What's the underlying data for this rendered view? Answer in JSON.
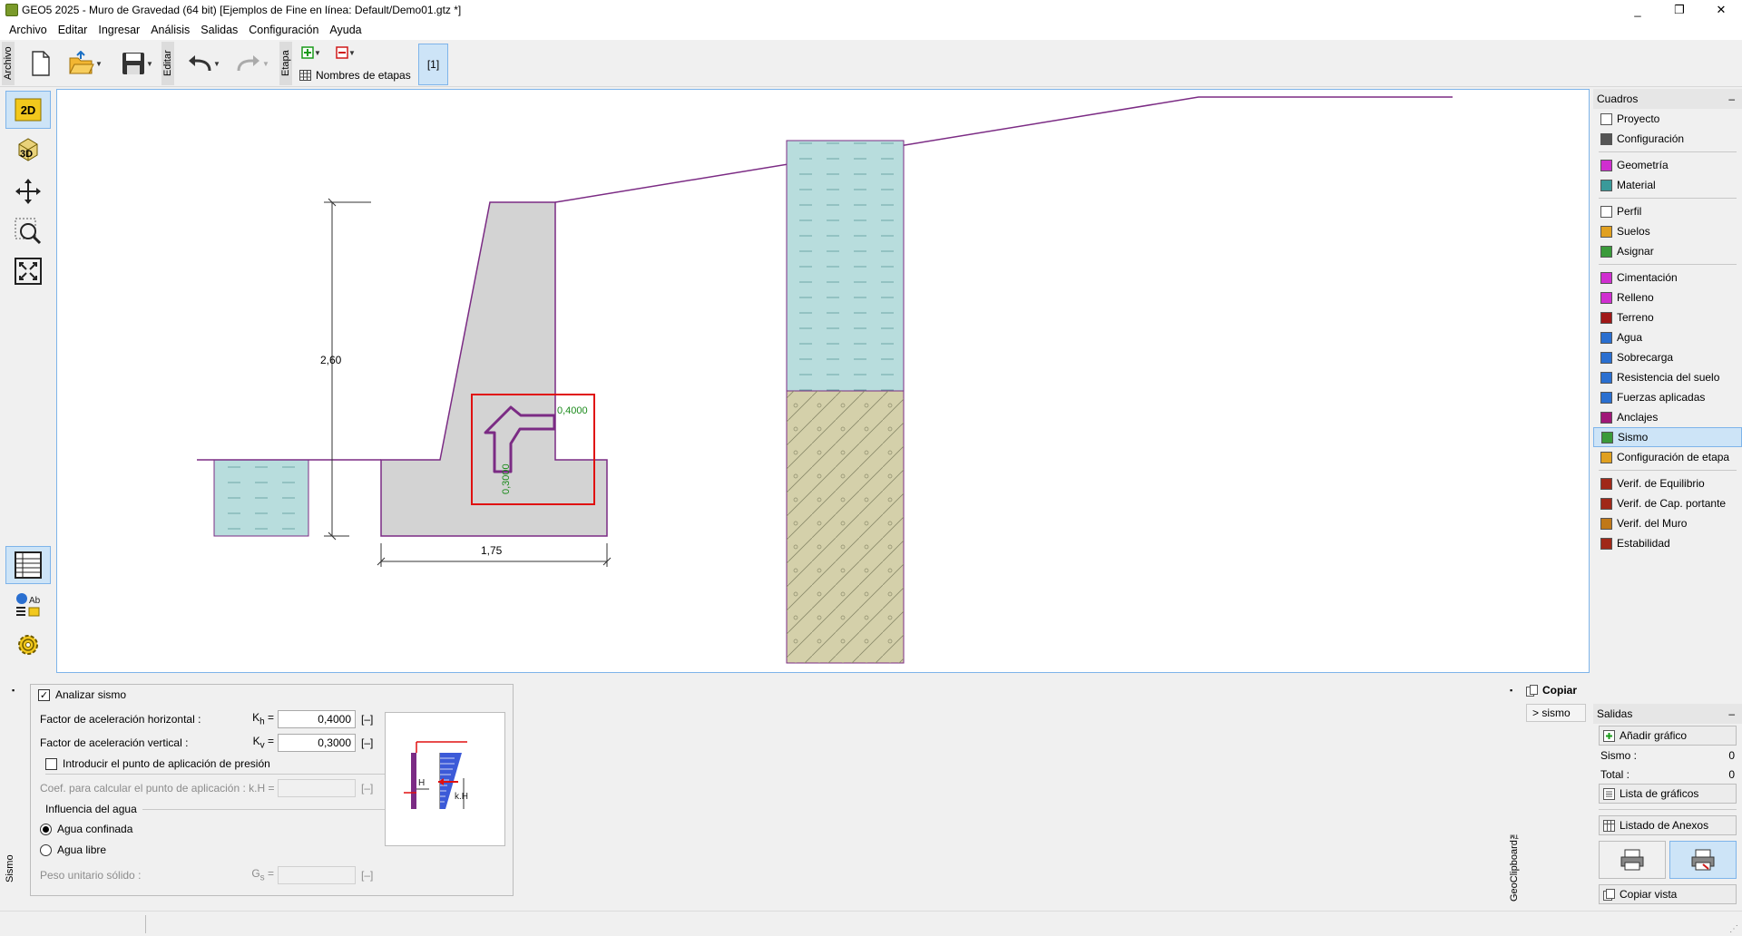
{
  "window": {
    "title": "GEO5 2025 - Muro de Gravedad (64 bit) [Ejemplos de Fine en línea: Default/Demo01.gtz *]",
    "controls": [
      "_",
      "❐",
      "✕"
    ]
  },
  "menu": [
    "Archivo",
    "Editar",
    "Ingresar",
    "Análisis",
    "Salidas",
    "Configuración",
    "Ayuda"
  ],
  "toolbar": {
    "archivo_label": "Archivo",
    "editar_label": "Editar",
    "etapa_label": "Etapa",
    "stage_names_label": "Nombres de etapas",
    "stage_tab": "[1]"
  },
  "leftbar": {
    "view2d": "2D",
    "view3d": "3D"
  },
  "drawing": {
    "height_dim": "2,60",
    "width_dim": "1,75",
    "kh_value": "0,4000",
    "kv_value": "0,3000"
  },
  "cuadros": {
    "title": "Cuadros",
    "collapse": "–",
    "groups": [
      [
        {
          "label": "Proyecto",
          "icon": "document-icon"
        },
        {
          "label": "Configuración",
          "icon": "gear-icon"
        }
      ],
      [
        {
          "label": "Geometría",
          "icon": "geometry-icon"
        },
        {
          "label": "Material",
          "icon": "material-icon"
        }
      ],
      [
        {
          "label": "Perfil",
          "icon": "profile-icon"
        },
        {
          "label": "Suelos",
          "icon": "soil-icon"
        },
        {
          "label": "Asignar",
          "icon": "assign-icon"
        }
      ],
      [
        {
          "label": "Cimentación",
          "icon": "foundation-icon"
        },
        {
          "label": "Relleno",
          "icon": "backfill-icon"
        },
        {
          "label": "Terreno",
          "icon": "terrain-icon"
        },
        {
          "label": "Agua",
          "icon": "water-icon"
        },
        {
          "label": "Sobrecarga",
          "icon": "surcharge-icon"
        },
        {
          "label": "Resistencia del suelo",
          "icon": "resistance-icon"
        },
        {
          "label": "Fuerzas aplicadas",
          "icon": "force-icon"
        },
        {
          "label": "Anclajes",
          "icon": "anchor-icon"
        },
        {
          "label": "Sismo",
          "icon": "earthquake-icon",
          "active": true
        },
        {
          "label": "Configuración de etapa",
          "icon": "stage-settings-icon"
        }
      ],
      [
        {
          "label": "Verif. de Equilibrio",
          "icon": "equilibrium-icon"
        },
        {
          "label": "Verif. de Cap. portante",
          "icon": "bearing-icon"
        },
        {
          "label": "Verif. del Muro",
          "icon": "wall-check-icon"
        },
        {
          "label": "Estabilidad",
          "icon": "stability-icon"
        }
      ]
    ]
  },
  "salidas": {
    "title": "Salidas",
    "collapse": "–",
    "add_graphic": "Añadir gráfico",
    "sismo_label": "Sismo :",
    "sismo_count": "0",
    "total_label": "Total :",
    "total_count": "0",
    "graphics_list": "Lista de gráficos",
    "annex_list": "Listado de Anexos",
    "copy_view": "Copiar vista"
  },
  "form": {
    "side_label": "Sismo",
    "analyze_label": "Analizar sismo",
    "analyze_checked": true,
    "kh_label": "Factor de aceleración horizontal  :",
    "kh_sym": "K",
    "kh_sub": "h",
    "kh_value": "0,4000",
    "kh_unit": "[–]",
    "kv_label": "Factor de aceleración vertical :",
    "kv_sym": "K",
    "kv_sub": "v",
    "kv_value": "0,3000",
    "kv_unit": "[–]",
    "point_label": "Introducir el punto de aplicación de presión",
    "coef_label": "Coef. para calcular el punto de aplicación : k.H =",
    "coef_unit": "[–]",
    "water_group": "Influencia del agua",
    "water_confined": "Agua confinada",
    "water_free": "Agua libre",
    "unit_weight_label": "Peso unitario sólido :",
    "gs_sym": "G",
    "gs_sub": "s",
    "gs_unit": "[–]",
    "diagram_h": "H",
    "diagram_kh": "k.H"
  },
  "clipboard": {
    "copy_label": "Copiar",
    "item": "> sismo",
    "side_label": "GeoClipboard™"
  },
  "colors": {
    "wall": "#d3d3d3",
    "outline": "#7b2b84",
    "water": "#b8dddd",
    "soil": "#d4d0aa",
    "highlight": "#e01010",
    "green": "#1a8a1a"
  }
}
